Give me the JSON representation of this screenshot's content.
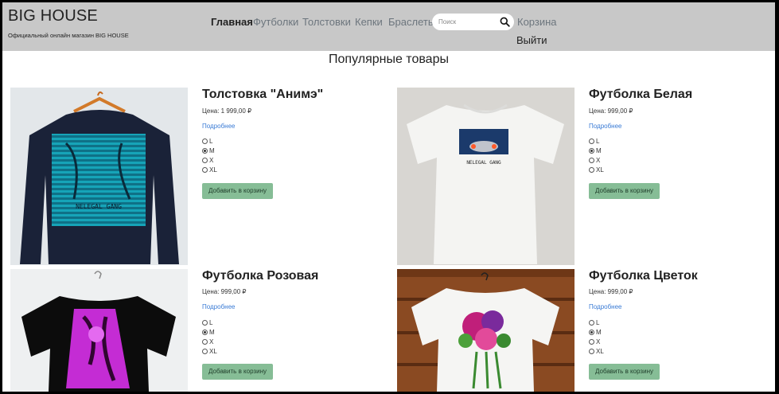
{
  "header": {
    "brand": "BIG HOUSE",
    "tagline": "Официальный онлайн магазин BIG HOUSE",
    "nav": [
      "Главная",
      "Футболки",
      "Толстовки",
      "Кепки",
      "Браслеты"
    ],
    "search_placeholder": "Поиск",
    "cart": "Корзина",
    "logout": "Выйти"
  },
  "main": {
    "title": "Популярные товары",
    "products": [
      {
        "title": "Толстовка \"Анимэ\"",
        "price": "Цена: 1 999,00 ₽",
        "more": "Подробнее",
        "sizes": [
          "L",
          "M",
          "X",
          "XL"
        ],
        "selected": "M",
        "button": "Добавить в корзину"
      },
      {
        "title": "Футболка Белая",
        "price": "Цена: 999,00 ₽",
        "more": "Подробнее",
        "sizes": [
          "L",
          "M",
          "X",
          "XL"
        ],
        "selected": "M",
        "button": "Добавить в корзину"
      },
      {
        "title": "Футболка Розовая",
        "price": "Цена: 999,00 ₽",
        "more": "Подробнее",
        "sizes": [
          "L",
          "M",
          "X",
          "XL"
        ],
        "selected": "M",
        "button": "Добавить в корзину"
      },
      {
        "title": "Футболка Цветок",
        "price": "Цена: 999,00 ₽",
        "more": "Подробнее",
        "sizes": [
          "L",
          "M",
          "X",
          "XL"
        ],
        "selected": "M",
        "button": "Добавить в корзину"
      }
    ]
  },
  "images": {
    "print_text_1": "NELEGAL GANG",
    "print_text_2": "NELEGAL GANG"
  },
  "colors": {
    "header_bg": "#c8c8c8",
    "button_bg": "#86bd96",
    "link": "#3a7bd5"
  }
}
